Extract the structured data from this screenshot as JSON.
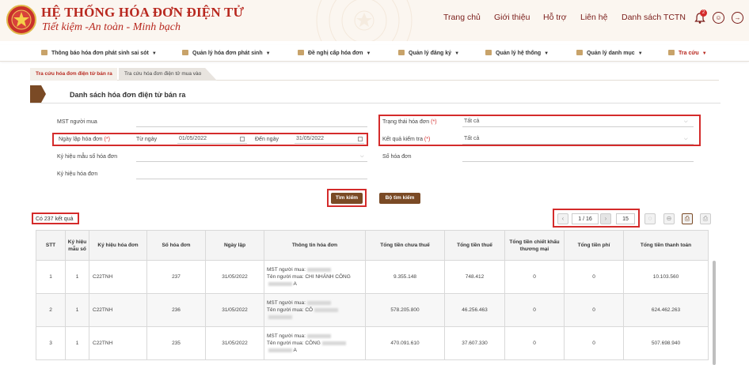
{
  "brand": {
    "title": "HỆ THỐNG HÓA ĐƠN ĐIỆN TỬ",
    "slogan": "Tiết kiệm -An toàn - Minh bạch"
  },
  "topnav": [
    "Trang chủ",
    "Giới thiệu",
    "Hỗ trợ",
    "Liên hệ",
    "Danh sách TCTN"
  ],
  "notifications": {
    "count": "2"
  },
  "menu": [
    "Thông báo hóa đơn phát sinh sai sót",
    "Quản lý hóa đơn phát sinh",
    "Đề nghị cấp hóa đơn",
    "Quản lý đăng ký",
    "Quản lý hệ thống",
    "Quản lý danh mục",
    "Tra cứu"
  ],
  "tabs": [
    "Tra cứu hóa đơn điện tử bán ra",
    "Tra cứu hóa đơn điện tử mua vào"
  ],
  "page_title": "Danh sách hóa đơn điện tử bán ra",
  "form": {
    "mst_label": "MST người mua",
    "date_label": "Ngày lập hóa đơn",
    "from_label": "Từ ngày",
    "from_value": "01/05/2022",
    "to_label": "Đến ngày",
    "to_value": "31/05/2022",
    "template_label": "Ký hiệu mẫu số hóa đơn",
    "symbol_label": "Ký hiệu hóa đơn",
    "status_label": "Trạng thái hóa đơn",
    "status_value": "Tất cả",
    "check_label": "Kết quả kiểm tra",
    "check_value": "Tất cả",
    "number_label": "Số hóa đơn",
    "required_mark": "(*)"
  },
  "buttons": {
    "search": "Tìm kiếm",
    "filter": "Bộ tìm kiếm"
  },
  "results": {
    "count_text": "Có 237 kết quả"
  },
  "pagination": {
    "page": "1 / 16",
    "page_size": "15",
    "prev": "‹",
    "next": "›"
  },
  "table": {
    "headers": [
      "STT",
      "Ký hiệu mẫu số",
      "Ký hiệu hóa đơn",
      "Số hóa đơn",
      "Ngày lập",
      "Thông tin hóa đơn",
      "Tổng tiền chưa thuế",
      "Tổng tiền thuế",
      "Tổng tiền chiết khấu thương mại",
      "Tổng tiền phí",
      "Tổng tiền thanh toán"
    ],
    "rows": [
      {
        "stt": "1",
        "mau_so": "1",
        "ky_hieu": "C22TNH",
        "so": "237",
        "ngay": "31/05/2022",
        "info1": "MST người mua:",
        "info2": "Tên người mua: CHI NHÁNH CÔNG",
        "info3": "A",
        "chua_thue": "9.355.148",
        "thue": "748.412",
        "chiet_khau": "0",
        "phi": "0",
        "thanh_toan": "10.103.560"
      },
      {
        "stt": "2",
        "mau_so": "1",
        "ky_hieu": "C22TNH",
        "so": "236",
        "ngay": "31/05/2022",
        "info1": "MST người mua:",
        "info2": "Tên người mua: CÔ",
        "info3": "",
        "chua_thue": "578.205.800",
        "thue": "46.256.463",
        "chiet_khau": "0",
        "phi": "0",
        "thanh_toan": "624.462.263"
      },
      {
        "stt": "3",
        "mau_so": "1",
        "ky_hieu": "C22TNH",
        "so": "235",
        "ngay": "31/05/2022",
        "info1": "MST người mua:",
        "info2": "Tên người mua: CÔNG",
        "info3": "A",
        "chua_thue": "470.091.610",
        "thue": "37.607.330",
        "chiet_khau": "0",
        "phi": "0",
        "thanh_toan": "507.698.940"
      }
    ]
  },
  "colors": {
    "brand_red": "#b8281f",
    "button_brown": "#7a4a25",
    "highlight_red": "#d42b2b"
  }
}
